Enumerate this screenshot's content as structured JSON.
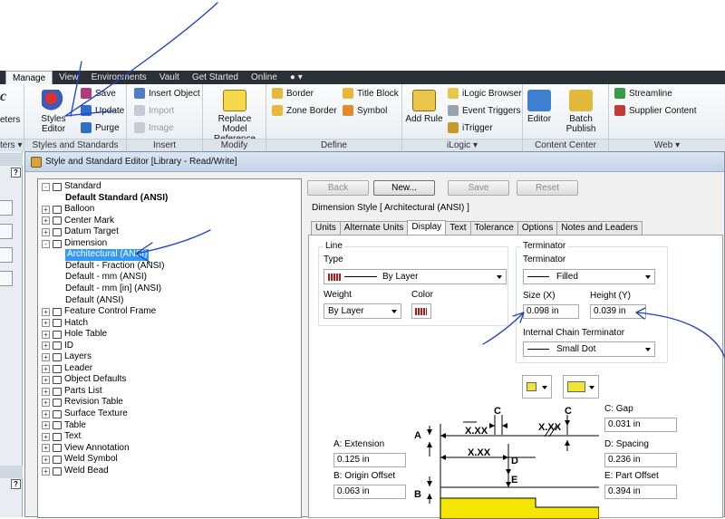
{
  "ribbon": {
    "tabs": [
      "Manage",
      "View",
      "Environments",
      "Vault",
      "Get Started",
      "Online"
    ],
    "active_tab": "Manage",
    "panels": {
      "left_partial": {
        "title": "ters ▾",
        "item": "eters",
        "logo": "c"
      },
      "styles": {
        "title": "Styles and Standards",
        "styles_editor": "Styles Editor",
        "save": "Save",
        "update": "Update",
        "purge": "Purge"
      },
      "insert": {
        "title": "Insert",
        "insert_object": "Insert Object",
        "import": "Import",
        "image": "Image"
      },
      "modify": {
        "title": "Modify",
        "replace_model": "Replace Model",
        "reference": "Reference"
      },
      "define": {
        "title": "Define",
        "border": "Border",
        "title_block": "Title Block",
        "zone_border": "Zone Border",
        "symbol": "Symbol"
      },
      "ilogic": {
        "title": "iLogic ▾",
        "add_rule": "Add Rule",
        "ilogic_browser": "iLogic Browser",
        "event_triggers": "Event Triggers",
        "itrigger": "iTrigger"
      },
      "content": {
        "title": "Content Center",
        "editor": "Editor",
        "batch_publish": "Batch Publish"
      },
      "web": {
        "title": "Web ▾",
        "streamline": "Streamline",
        "supplier_content": "Supplier Content"
      }
    }
  },
  "left_strip": {
    "help": "?"
  },
  "dialog": {
    "title": "Style and Standard Editor [Library - Read/Write]",
    "buttons": {
      "back": "Back",
      "new": "New...",
      "save": "Save",
      "reset": "Reset"
    },
    "style_label": "Dimension Style [ Architectural (ANSI) ]",
    "tabs": [
      "Units",
      "Alternate Units",
      "Display",
      "Text",
      "Tolerance",
      "Options",
      "Notes and Leaders"
    ],
    "active_tab": "Display",
    "tree": [
      {
        "label": "Standard",
        "level": 0,
        "expander": "-",
        "icon": "standard-icon"
      },
      {
        "label": "Default Standard (ANSI)",
        "level": 1,
        "bold": true
      },
      {
        "label": "Balloon",
        "level": 0,
        "expander": "+",
        "icon": "balloon-icon"
      },
      {
        "label": "Center Mark",
        "level": 0,
        "expander": "+",
        "icon": "center-mark-icon"
      },
      {
        "label": "Datum Target",
        "level": 0,
        "expander": "+",
        "icon": "datum-target-icon"
      },
      {
        "label": "Dimension",
        "level": 0,
        "expander": "-",
        "icon": "dimension-icon"
      },
      {
        "label": "Architectural (ANSI)",
        "level": 1,
        "selected": true
      },
      {
        "label": "Default - Fraction (ANSI)",
        "level": 1
      },
      {
        "label": "Default - mm (ANSI)",
        "level": 1
      },
      {
        "label": "Default - mm [in] (ANSI)",
        "level": 1
      },
      {
        "label": "Default (ANSI)",
        "level": 1
      },
      {
        "label": "Feature Control Frame",
        "level": 0,
        "expander": "+",
        "icon": "fcf-icon"
      },
      {
        "label": "Hatch",
        "level": 0,
        "expander": "+",
        "icon": "hatch-icon"
      },
      {
        "label": "Hole Table",
        "level": 0,
        "expander": "+",
        "icon": "hole-table-icon"
      },
      {
        "label": "ID",
        "level": 0,
        "expander": "+",
        "icon": "id-icon"
      },
      {
        "label": "Layers",
        "level": 0,
        "expander": "+",
        "icon": "layers-icon"
      },
      {
        "label": "Leader",
        "level": 0,
        "expander": "+",
        "icon": "leader-icon"
      },
      {
        "label": "Object Defaults",
        "level": 0,
        "expander": "+",
        "icon": "object-defaults-icon"
      },
      {
        "label": "Parts List",
        "level": 0,
        "expander": "+",
        "icon": "parts-list-icon"
      },
      {
        "label": "Revision Table",
        "level": 0,
        "expander": "+",
        "icon": "revision-table-icon"
      },
      {
        "label": "Surface Texture",
        "level": 0,
        "expander": "+",
        "icon": "surface-texture-icon"
      },
      {
        "label": "Table",
        "level": 0,
        "expander": "+",
        "icon": "table-icon"
      },
      {
        "label": "Text",
        "level": 0,
        "expander": "+",
        "icon": "text-icon"
      },
      {
        "label": "View Annotation",
        "level": 0,
        "expander": "+",
        "icon": "view-annotation-icon"
      },
      {
        "label": "Weld Symbol",
        "level": 0,
        "expander": "+",
        "icon": "weld-symbol-icon"
      },
      {
        "label": "Weld Bead",
        "level": 0,
        "expander": "+",
        "icon": "weld-bead-icon"
      }
    ],
    "display": {
      "line": {
        "group": "Line",
        "type_label": "Type",
        "type_value": "By Layer",
        "weight_label": "Weight",
        "weight_value": "By Layer",
        "color_label": "Color"
      },
      "terminator": {
        "group": "Terminator",
        "label": "Terminator",
        "value": "Filled",
        "size_label": "Size (X)",
        "size_value": "0.098 in",
        "height_label": "Height (Y)",
        "height_value": "0.039 in",
        "chain_label": "Internal Chain Terminator",
        "chain_value": "Small Dot"
      },
      "extension": {
        "label": "A: Extension",
        "value": "0.125 in"
      },
      "origin_offset": {
        "label": "B: Origin Offset",
        "value": "0.063 in"
      },
      "gap": {
        "label": "C: Gap",
        "value": "0.031 in"
      },
      "spacing": {
        "label": "D: Spacing",
        "value": "0.236 in"
      },
      "part_offset": {
        "label": "E: Part Offset",
        "value": "0.394 in"
      },
      "diagram": {
        "a": "A",
        "b": "B",
        "c1": "C",
        "c2": "C",
        "d": "D",
        "e": "E",
        "dim1": "X.XX",
        "dim2": "X.XX",
        "dim3": "X.XX"
      }
    }
  },
  "colors": {
    "annotation": "#1f3fbf",
    "selection": "#3399ff",
    "part_fill": "#f5e600"
  }
}
